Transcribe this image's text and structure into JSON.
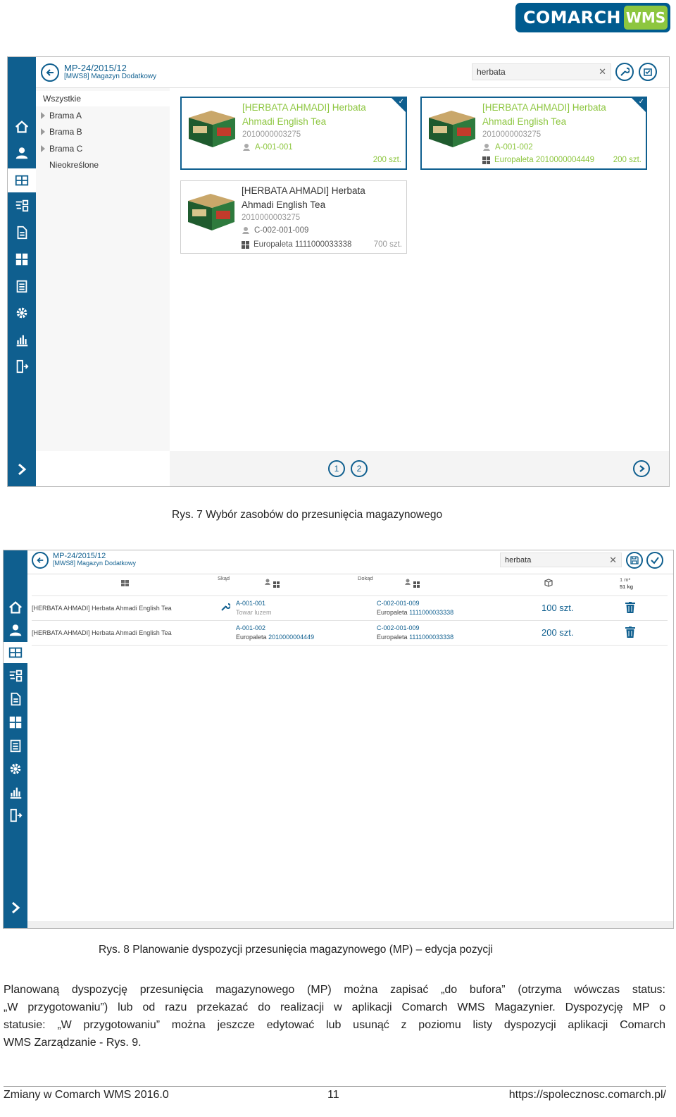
{
  "logo": {
    "brand": "COMARCH",
    "product": "WMS"
  },
  "screen1": {
    "doc_number": "MP-24/2015/12",
    "doc_warehouse": "[MWS8] Magazyn Dodatkowy",
    "search_value": "herbata",
    "tree": [
      {
        "label": "Wszystkie",
        "expandable": false
      },
      {
        "label": "Brama A",
        "expandable": true
      },
      {
        "label": "Brama B",
        "expandable": true
      },
      {
        "label": "Brama C",
        "expandable": true
      },
      {
        "label": "Nieokreślone",
        "expandable": false
      }
    ],
    "cards": [
      {
        "name": "[HERBATA AHMADI] Herbata Ahmadi English Tea",
        "code": "2010000003275",
        "location": "A-001-001",
        "pallet": "",
        "qty": "200 szt.",
        "selected": true
      },
      {
        "name": "[HERBATA AHMADI] Herbata Ahmadi English Tea",
        "code": "2010000003275",
        "location": "A-001-002",
        "pallet": "Europaleta 2010000004449",
        "qty": "200 szt.",
        "selected": true
      },
      {
        "name": "[HERBATA AHMADI] Herbata Ahmadi English Tea",
        "code": "2010000003275",
        "location": "C-002-001-009",
        "pallet": "Europaleta 1111000033338",
        "qty": "700 szt.",
        "selected": false
      }
    ],
    "pages": [
      "1",
      "2"
    ]
  },
  "caption1": "Rys. 7 Wybór zasobów do przesunięcia magazynowego",
  "screen2": {
    "doc_number": "MP-24/2015/12",
    "doc_warehouse": "[MWS8] Magazyn Dodatkowy",
    "search_value": "herbata",
    "col_source": "Skąd",
    "col_target": "Dokąd",
    "volume": "1 m³",
    "weight": "51 kg",
    "rows": [
      {
        "name": "[HERBATA AHMADI] Herbata Ahmadi English Tea",
        "src_loc": "A-001-001",
        "src_carrier": "Towar luzem",
        "src_pallet_label": "",
        "src_pallet_no": "",
        "dst_loc": "C-002-001-009",
        "dst_pallet_label": "Europaleta",
        "dst_pallet_no": "1111000033338",
        "qty": "100 szt."
      },
      {
        "name": "[HERBATA AHMADI] Herbata Ahmadi English Tea",
        "src_loc": "A-001-002",
        "src_carrier": "",
        "src_pallet_label": "Europaleta",
        "src_pallet_no": "2010000004449",
        "dst_loc": "C-002-001-009",
        "dst_pallet_label": "Europaleta",
        "dst_pallet_no": "1111000033338",
        "qty": "200 szt."
      }
    ]
  },
  "caption2": "Rys. 8 Planowanie dyspozycji przesunięcia magazynowego (MP) – edycja pozycji",
  "paragraph": [
    "Planowaną dyspozycję przesunięcia magazynowego (MP) można zapisać „do bufora” (otrzyma wówczas status:",
    "„W przygotowaniu”) lub od razu przekazać do realizacji w aplikacji Comarch WMS Magazynier. Dyspozycję MP o",
    "statusie: „W przygotowaniu” można jeszcze edytować lub usunąć z poziomu listy dyspozycji aplikacji Comarch",
    "WMS Zarządzanie - Rys. 9."
  ],
  "footer": {
    "left": "Zmiany w Comarch WMS 2016.0",
    "page": "11",
    "right": "https://spolecznosc.comarch.pl/"
  },
  "colors": {
    "primary": "#0f5f8f",
    "accent": "#8dc63f"
  }
}
